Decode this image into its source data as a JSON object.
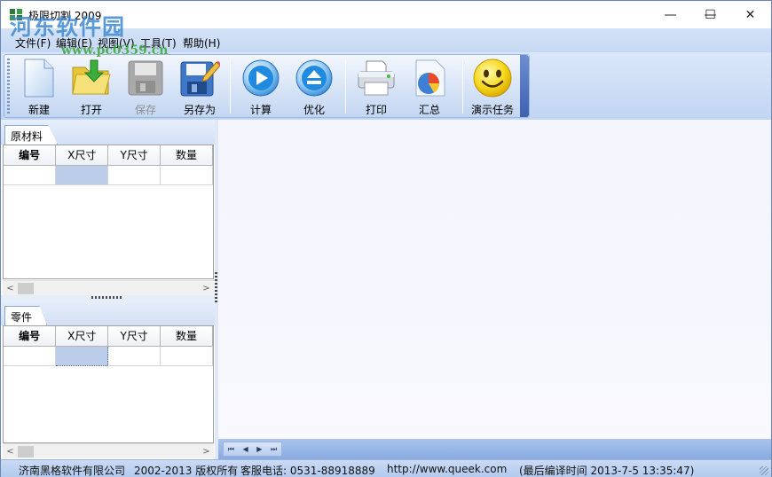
{
  "window": {
    "title": "极限切割 2009",
    "watermark": "河东软件园",
    "watermark_url": "www.pc0359.cn",
    "controls": {
      "minimize": "—",
      "maximize": "☐",
      "close": "✕"
    }
  },
  "menu": [
    {
      "label": "文件(F)"
    },
    {
      "label": "编辑(E)"
    },
    {
      "label": "视图(V)"
    },
    {
      "label": "工具(T)"
    },
    {
      "label": "帮助(H)"
    }
  ],
  "toolbar": [
    {
      "label": "新建",
      "icon": "new-file-icon",
      "enabled": true
    },
    {
      "label": "打开",
      "icon": "open-folder-icon",
      "enabled": true
    },
    {
      "label": "保存",
      "icon": "save-disk-icon",
      "enabled": false
    },
    {
      "label": "另存为",
      "icon": "save-as-icon",
      "enabled": true
    },
    {
      "label": "计算",
      "icon": "play-icon",
      "enabled": true
    },
    {
      "label": "优化",
      "icon": "eject-icon",
      "enabled": true
    },
    {
      "label": "打印",
      "icon": "printer-icon",
      "enabled": true
    },
    {
      "label": "汇总",
      "icon": "pie-chart-icon",
      "enabled": true
    },
    {
      "label": "演示任务",
      "icon": "smiley-icon",
      "enabled": true
    }
  ],
  "materials_panel": {
    "tab": "原材料",
    "columns": [
      "编号",
      "X尺寸",
      "Y尺寸",
      "数量"
    ]
  },
  "parts_panel": {
    "tab": "零件",
    "columns": [
      "编号",
      "X尺寸",
      "Y尺寸",
      "数量"
    ]
  },
  "nav_buttons": {
    "first": "⏮",
    "prev": "◀",
    "next": "▶",
    "last": "⏭"
  },
  "scroll": {
    "left": "<",
    "right": ">"
  },
  "status": {
    "company": "济南黑格软件有限公司",
    "copyright": "2002-2013 版权所有",
    "phone": "客服电话: 0531-88918889",
    "url": "http://www.queek.com",
    "build": "(最后编译时间 2013-7-5 13:35:47)"
  },
  "colors": {
    "accent": "#c1d5f2",
    "selection": "#bccde9",
    "workspace": "#f6f6fe"
  }
}
